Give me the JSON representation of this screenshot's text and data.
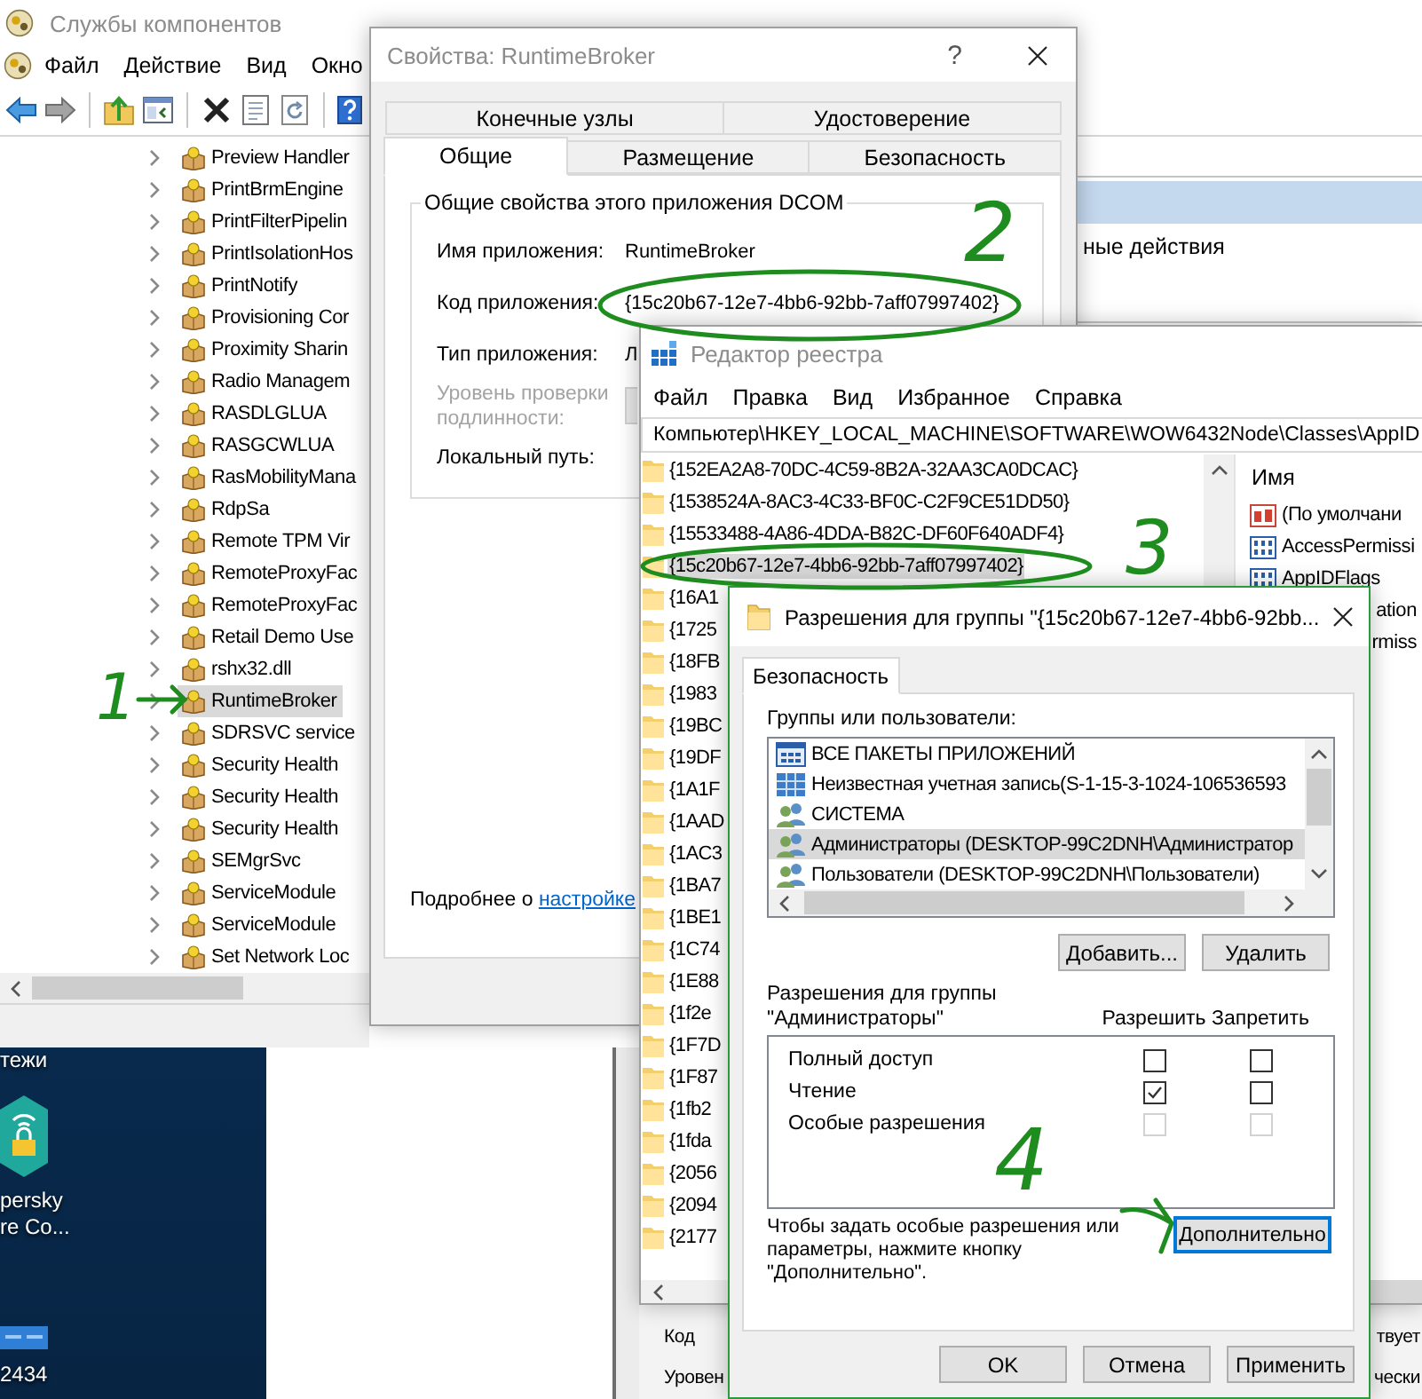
{
  "component_services": {
    "title": "Службы компонентов",
    "active": false,
    "menu": [
      "Файл",
      "Действие",
      "Вид",
      "Окно"
    ],
    "tree": [
      {
        "label": "Preview Handler",
        "selected": false
      },
      {
        "label": "PrintBrmEngine",
        "selected": false
      },
      {
        "label": "PrintFilterPipelin",
        "selected": false
      },
      {
        "label": "PrintIsolationHos",
        "selected": false
      },
      {
        "label": "PrintNotify",
        "selected": false
      },
      {
        "label": "Provisioning Cor",
        "selected": false
      },
      {
        "label": "Proximity Sharin",
        "selected": false
      },
      {
        "label": "Radio Managem",
        "selected": false
      },
      {
        "label": "RASDLGLUA",
        "selected": false
      },
      {
        "label": "RASGCWLUA",
        "selected": false
      },
      {
        "label": "RasMobilityMana",
        "selected": false
      },
      {
        "label": "RdpSa",
        "selected": false
      },
      {
        "label": "Remote TPM Vir",
        "selected": false
      },
      {
        "label": "RemoteProxyFac",
        "selected": false
      },
      {
        "label": "RemoteProxyFac",
        "selected": false
      },
      {
        "label": "Retail Demo Use",
        "selected": false
      },
      {
        "label": "rshx32.dll",
        "selected": false
      },
      {
        "label": "RuntimeBroker",
        "selected": true
      },
      {
        "label": "SDRSVC service",
        "selected": false
      },
      {
        "label": "Security Health",
        "selected": false
      },
      {
        "label": "Security Health",
        "selected": false
      },
      {
        "label": "Security Health",
        "selected": false
      },
      {
        "label": "SEMgrSvc",
        "selected": false
      },
      {
        "label": "ServiceModule",
        "selected": false
      },
      {
        "label": "ServiceModule",
        "selected": false
      },
      {
        "label": "Set Network Loc",
        "selected": false
      }
    ],
    "actions_pane": {
      "item": "ные действия"
    }
  },
  "properties_dialog": {
    "title": "Свойства: RuntimeBroker",
    "active": false,
    "help": "?",
    "tab_rows": [
      {
        "tabs": [
          {
            "label": "Конечные узлы",
            "selected": false
          },
          {
            "label": "Удостоверение",
            "selected": false
          }
        ]
      },
      {
        "tabs": [
          {
            "label": "Общие",
            "selected": true
          },
          {
            "label": "Размещение",
            "selected": false
          },
          {
            "label": "Безопасность",
            "selected": false
          }
        ]
      }
    ],
    "group": {
      "legend": "Общие свойства этого приложения DCOM",
      "fields": [
        {
          "label": "Имя приложения:",
          "kind": "text",
          "value": "RuntimeBroker",
          "disabled": false
        },
        {
          "label": "Код приложения:",
          "kind": "text",
          "value": "{15c20b67-12e7-4bb6-92bb-7aff07997402}",
          "disabled": false
        },
        {
          "label": "Тип приложения:",
          "kind": "text",
          "value": "Л",
          "disabled": false
        },
        {
          "label": "Уровень проверки подлинности:",
          "kind": "select",
          "disabled": true
        },
        {
          "label": "Локальный путь:",
          "kind": "text",
          "disabled": false
        }
      ]
    },
    "more_info": {
      "text": "Подробнее о",
      "link": "настройке"
    }
  },
  "registry_editor": {
    "title": "Редактор реестра",
    "active": false,
    "menu": [
      "Файл",
      "Правка",
      "Вид",
      "Избранное",
      "Справка"
    ],
    "address": "Компьютер\\HKEY_LOCAL_MACHINE\\SOFTWARE\\WOW6432Node\\Classes\\AppID",
    "keys": [
      {
        "label": "{152EA2A8-70DC-4C59-8B2A-32AA3CA0DCAC}",
        "selected": false
      },
      {
        "label": "{1538524A-8AC3-4C33-BF0C-C2F9CE51DD50}",
        "selected": false
      },
      {
        "label": "{15533488-4A86-4DDA-B82C-DF60F640ADF4}",
        "selected": false
      },
      {
        "label": "{15c20b67-12e7-4bb6-92bb-7aff07997402}",
        "selected": true
      },
      {
        "label": "{16A1",
        "selected": false
      },
      {
        "label": "{1725",
        "selected": false
      },
      {
        "label": "{18FB",
        "selected": false
      },
      {
        "label": "{1983",
        "selected": false
      },
      {
        "label": "{19BC",
        "selected": false
      },
      {
        "label": "{19DF",
        "selected": false
      },
      {
        "label": "{1A1F",
        "selected": false
      },
      {
        "label": "{1AAD",
        "selected": false
      },
      {
        "label": "{1AC3",
        "selected": false
      },
      {
        "label": "{1BA7",
        "selected": false
      },
      {
        "label": "{1BE1",
        "selected": false
      },
      {
        "label": "{1C74",
        "selected": false
      },
      {
        "label": "{1E88",
        "selected": false
      },
      {
        "label": "{1f2e",
        "selected": false
      },
      {
        "label": "{1F7D",
        "selected": false
      },
      {
        "label": "{1F87",
        "selected": false
      },
      {
        "label": "{1fb2",
        "selected": false
      },
      {
        "label": "{1fda",
        "selected": false
      },
      {
        "label": "{2056",
        "selected": false
      },
      {
        "label": "{2094",
        "selected": false
      },
      {
        "label": "{2177",
        "selected": false
      }
    ],
    "values_header": "Имя",
    "values": [
      {
        "name": "(По умолчани",
        "kind": "string"
      },
      {
        "name": "AccessPermissi",
        "kind": "binary"
      },
      {
        "name": "AppIDFlags",
        "kind": "binary"
      },
      {
        "name": "ation",
        "kind": "clipped"
      },
      {
        "name": "rmiss",
        "kind": "clipped"
      }
    ]
  },
  "permissions_dialog": {
    "title": "Разрешения для группы \"{15c20b67-12e7-4bb6-92bb...",
    "active": true,
    "tabs": [
      {
        "label": "Безопасность",
        "selected": true
      }
    ],
    "groups_label": "Группы или пользователи:",
    "principals": [
      {
        "name": "ВСЕ ПАКЕТЫ ПРИЛОЖЕНИЙ",
        "kind": "package",
        "selected": false
      },
      {
        "name": "Неизвестная учетная запись(S-1-15-3-1024-106536593",
        "kind": "account",
        "selected": false
      },
      {
        "name": "СИСТЕМА",
        "kind": "group",
        "selected": false
      },
      {
        "name": "Администраторы (DESKTOP-99C2DNH\\Администратор",
        "kind": "group",
        "selected": true
      },
      {
        "name": "Пользователи (DESKTOP-99C2DNH\\Пользователи)",
        "kind": "group",
        "selected": false
      }
    ],
    "list_buttons": [
      "Добавить...",
      "Удалить"
    ],
    "permissions_caption": "Разрешения для группы \"Администраторы\"",
    "columns": [
      "Разрешить",
      "Запретить"
    ],
    "permissions": [
      {
        "name": "Полный доступ",
        "allow": {
          "checked": false,
          "disabled": false
        },
        "deny": {
          "checked": false,
          "disabled": false
        }
      },
      {
        "name": "Чтение",
        "allow": {
          "checked": true,
          "disabled": false
        },
        "deny": {
          "checked": false,
          "disabled": false
        }
      },
      {
        "name": "Особые разрешения",
        "allow": {
          "checked": false,
          "disabled": true
        },
        "deny": {
          "checked": false,
          "disabled": true
        }
      }
    ],
    "hint": "Чтобы задать особые разрешения или параметры, нажмите кнопку \"Дополнительно\".",
    "advanced_button": {
      "label": "Дополнительно",
      "focused": true
    },
    "buttons": [
      "OK",
      "Отмена",
      "Применить"
    ]
  },
  "desktop_icons": [
    {
      "kind": "caption",
      "lines": [
        "тежи"
      ]
    },
    {
      "kind": "hexagon",
      "lines": [
        "persky",
        "re Co..."
      ]
    },
    {
      "kind": "tile",
      "lines": [
        "2434"
      ]
    }
  ],
  "lower_window": {
    "rows": [
      {
        "left": "Код",
        "right": "твует"
      },
      {
        "left": "Уровен",
        "right": "чески"
      }
    ]
  },
  "annotations": [
    {
      "label": "1",
      "kind": "arrow"
    },
    {
      "label": "2",
      "kind": "ellipse"
    },
    {
      "label": "3",
      "kind": "ellipse"
    },
    {
      "label": "4",
      "kind": "arrow"
    }
  ]
}
